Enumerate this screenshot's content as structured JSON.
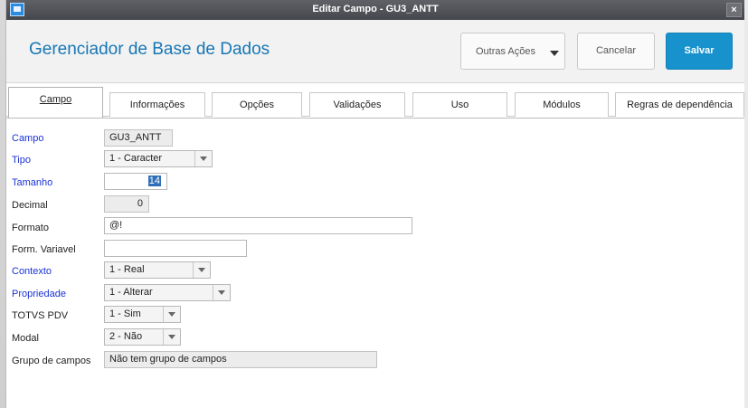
{
  "window": {
    "title": "Editar Campo - GU3_ANTT",
    "close_symbol": "×"
  },
  "header": {
    "title": "Gerenciador de Base de Dados",
    "buttons": {
      "outras": "Outras Ações",
      "cancelar": "Cancelar",
      "salvar": "Salvar"
    }
  },
  "tabs": [
    {
      "label": "Campo",
      "active": true
    },
    {
      "label": "Informações"
    },
    {
      "label": "Opções"
    },
    {
      "label": "Validações"
    },
    {
      "label": "Uso"
    },
    {
      "label": "Módulos"
    },
    {
      "label": "Regras de dependência"
    }
  ],
  "fields": {
    "campo": {
      "label": "Campo",
      "value": "GU3_ANTT"
    },
    "tipo": {
      "label": "Tipo",
      "value": "1 - Caracter"
    },
    "tamanho": {
      "label": "Tamanho",
      "value": "14"
    },
    "decimal": {
      "label": "Decimal",
      "value": "0"
    },
    "formato": {
      "label": "Formato",
      "value": "@!"
    },
    "form_variavel": {
      "label": "Form. Variavel",
      "value": ""
    },
    "contexto": {
      "label": "Contexto",
      "value": "1 - Real"
    },
    "propriedade": {
      "label": "Propriedade",
      "value": "1 - Alterar"
    },
    "totvs_pdv": {
      "label": "TOTVS PDV",
      "value": "1 - Sim"
    },
    "modal": {
      "label": "Modal",
      "value": "2 - Não"
    },
    "grupo_campos": {
      "label": "Grupo de campos",
      "value": "Não tem grupo de campos"
    }
  },
  "colors": {
    "accent": "#1777b5",
    "primary_button": "#1892cc",
    "required_label": "#1a33d6"
  }
}
